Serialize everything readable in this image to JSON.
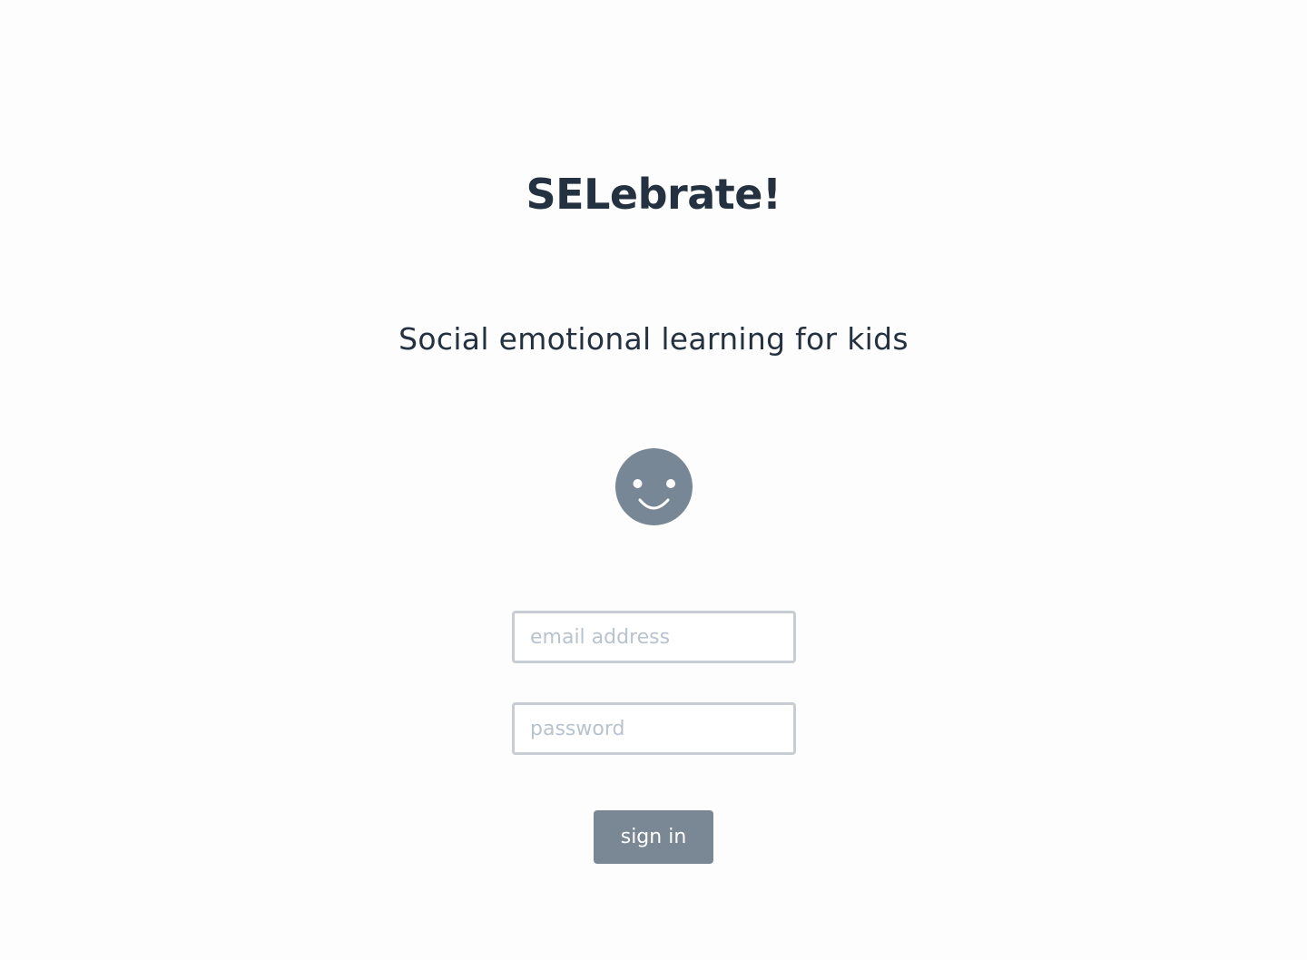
{
  "app": {
    "title": "SELebrate!",
    "tagline": "Social emotional learning for kids"
  },
  "logo": {
    "icon": "smiley-face-icon",
    "color": "#788796"
  },
  "login_form": {
    "email": {
      "value": "",
      "placeholder": "email address"
    },
    "password": {
      "value": "",
      "placeholder": "password"
    },
    "submit_label": "sign in"
  },
  "colors": {
    "text": "#233140",
    "button": "#7a8896",
    "input_border": "#c7cdd3",
    "placeholder": "#b7c3cf",
    "background": "#fdfdfd"
  }
}
